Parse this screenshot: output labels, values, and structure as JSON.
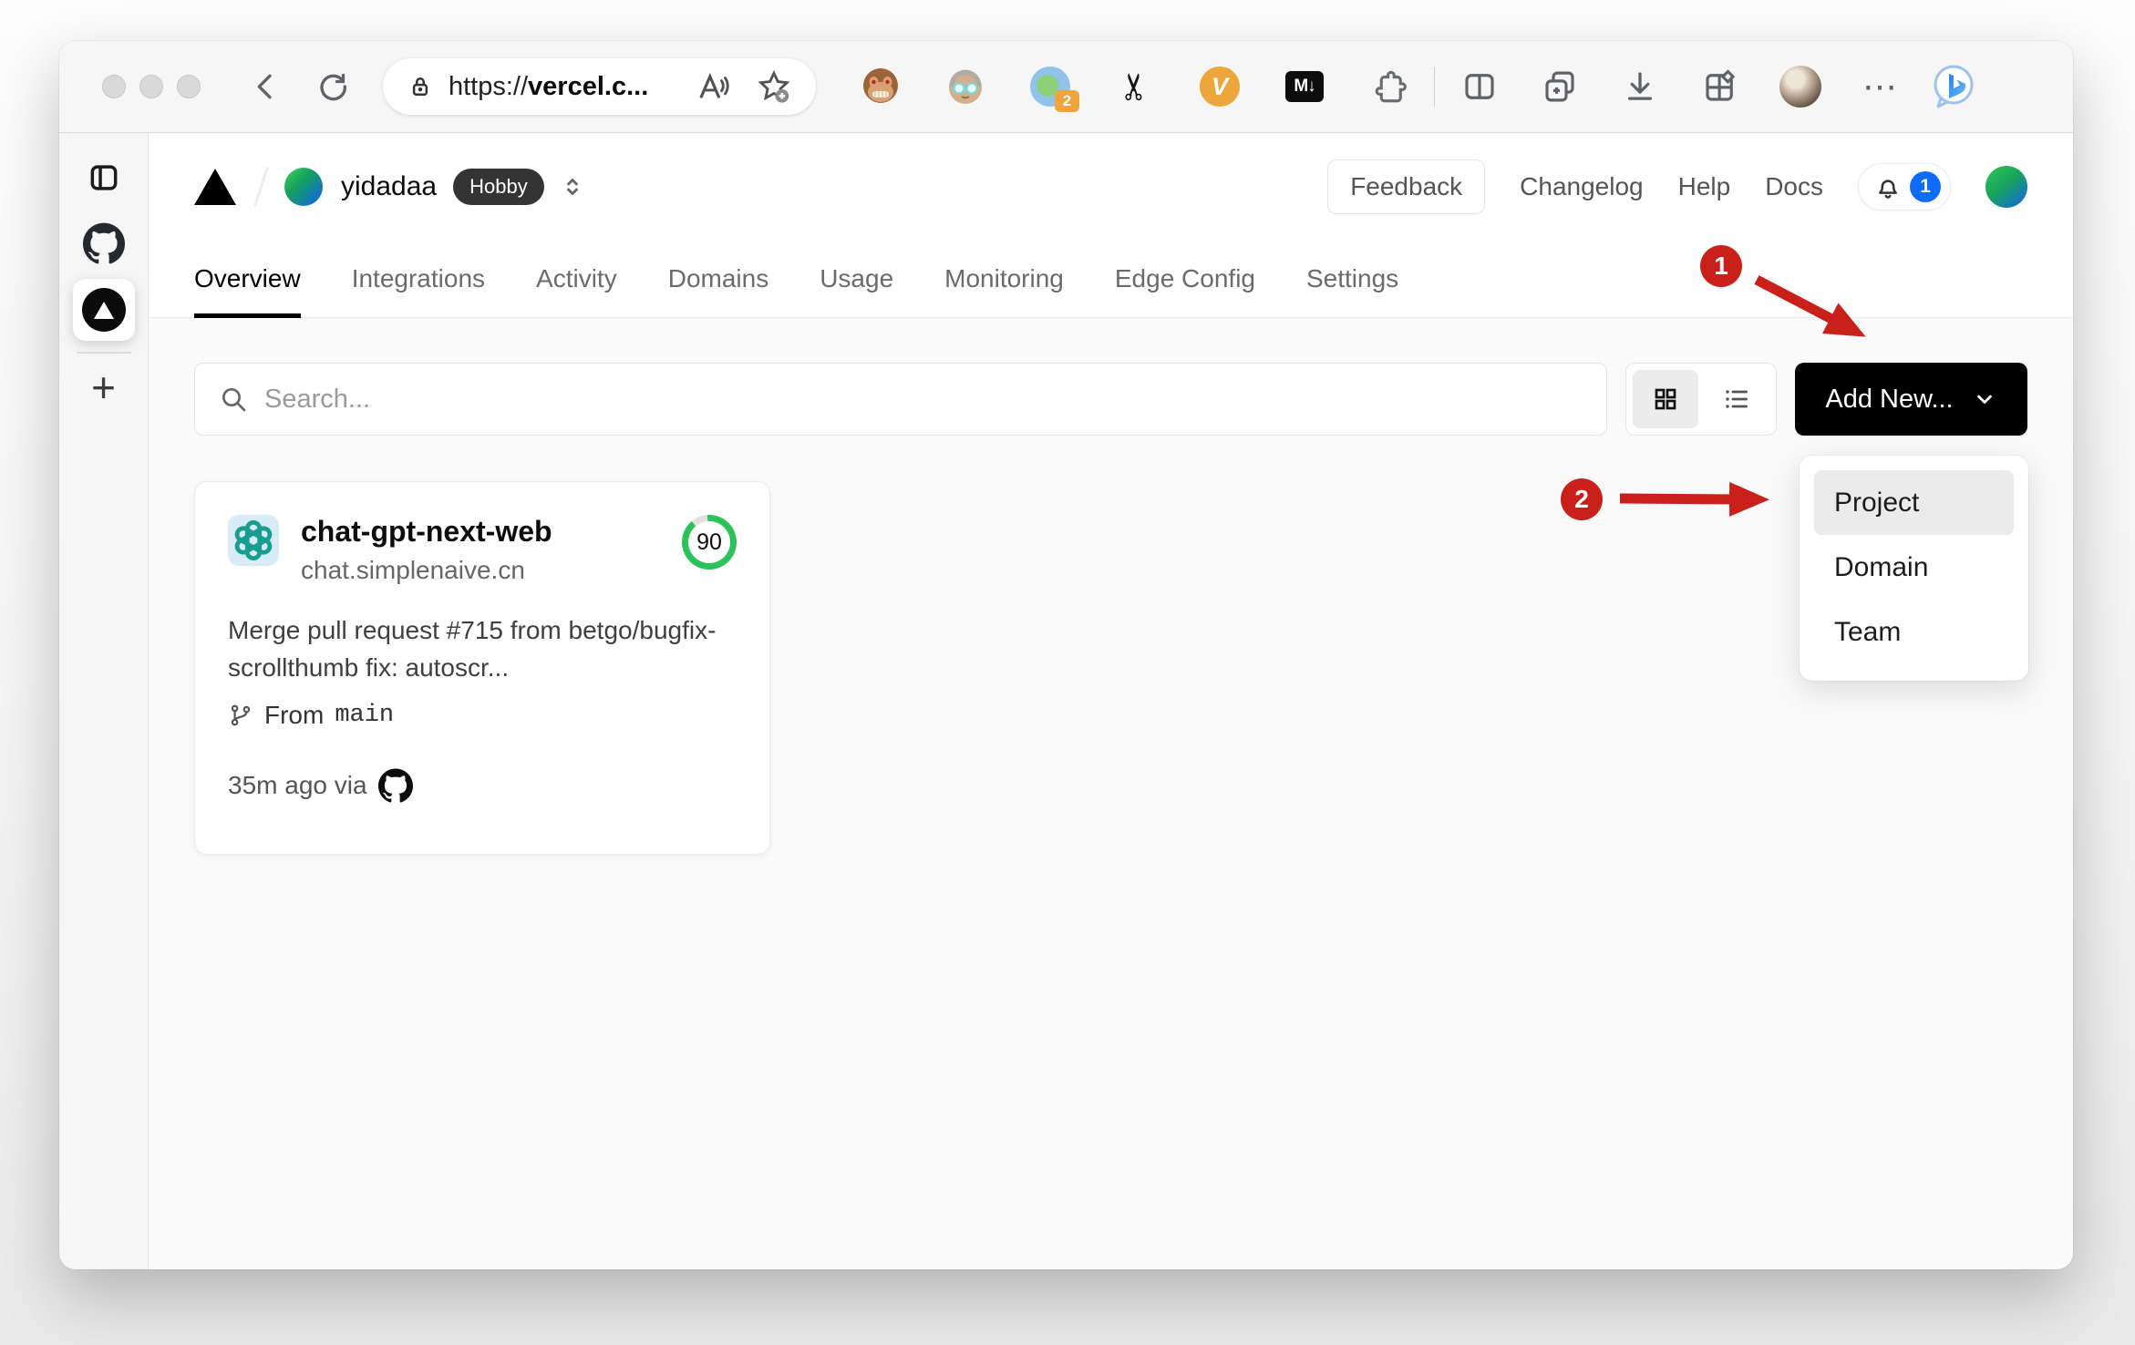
{
  "browser": {
    "url_scheme": "https://",
    "url_host": "vercel.c...",
    "proxy_badge": "2",
    "icons": {
      "more": "⋯",
      "scissors": "✂",
      "markdown": "M↓",
      "v_ext": "V",
      "plus": "+"
    }
  },
  "vercel": {
    "team": {
      "name": "yidadaa",
      "plan": "Hobby"
    },
    "nav": {
      "feedback": "Feedback",
      "changelog": "Changelog",
      "help": "Help",
      "docs": "Docs",
      "notification_count": "1"
    },
    "tabs": [
      {
        "label": "Overview",
        "active": true
      },
      {
        "label": "Integrations"
      },
      {
        "label": "Activity"
      },
      {
        "label": "Domains"
      },
      {
        "label": "Usage"
      },
      {
        "label": "Monitoring"
      },
      {
        "label": "Edge Config"
      },
      {
        "label": "Settings"
      }
    ],
    "controls": {
      "search_placeholder": "Search...",
      "add_new_label": "Add New..."
    },
    "project_card": {
      "name": "chat-gpt-next-web",
      "domain": "chat.simplenaive.cn",
      "score": "90",
      "commit_message": "Merge pull request #715 from betgo/bugfix-scrollthumb fix: autoscr...",
      "branch_prefix": "From",
      "branch_name": "main",
      "deploy_meta": "35m ago via"
    },
    "dropdown": {
      "items": [
        "Project",
        "Domain",
        "Team"
      ]
    }
  },
  "annotations": {
    "step1": "1",
    "step2": "2"
  },
  "colors": {
    "annotation_red": "#c9211a",
    "accent_blue": "#0b6cff",
    "score_green": "#2bc25a",
    "plan_badge_bg": "#343434"
  }
}
